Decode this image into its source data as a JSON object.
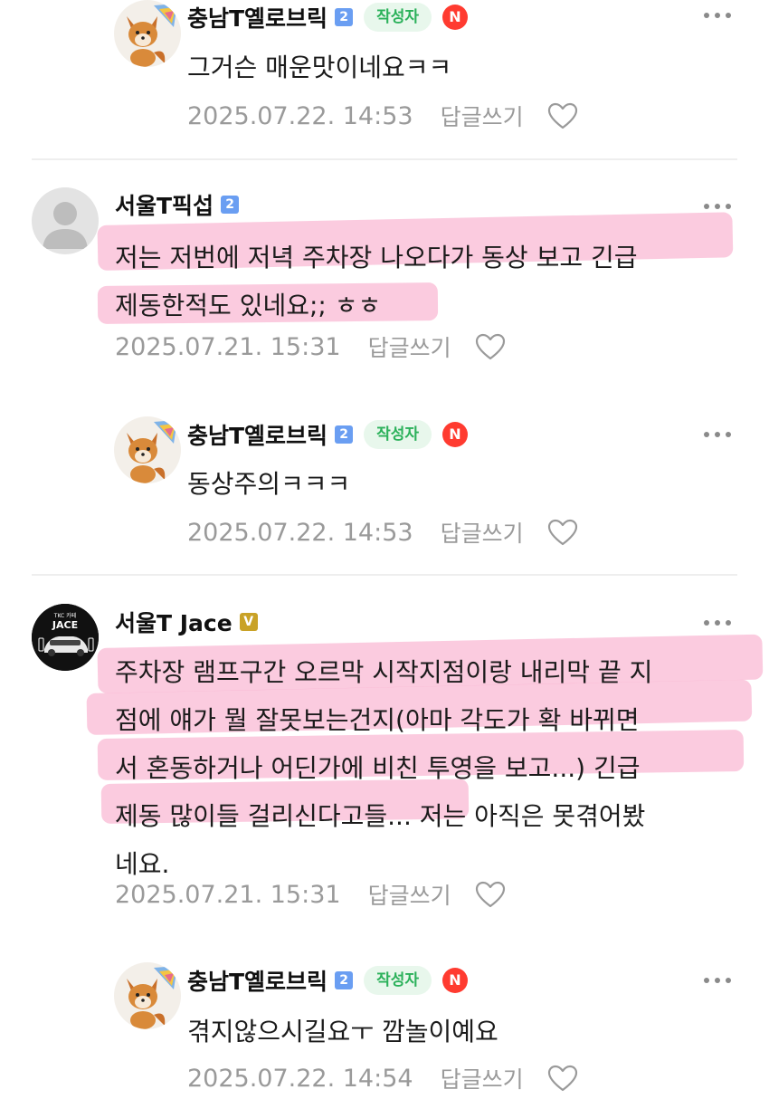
{
  "comments": [
    {
      "author": "충남T옐로브릭",
      "grade": "2",
      "writer_badge": "작성자",
      "new_badge": "N",
      "text_lines": [
        "그거슨 매운맛이네요ㅋㅋ"
      ],
      "date": "2025.07.22. 14:53",
      "reply_label": "답글쓰기",
      "avatar_icon": "fox-avatar"
    },
    {
      "author": "서울T픽섭",
      "grade": "2",
      "text_lines": [
        "저는 저번에 저녁 주차장 나오다가 동상 보고 긴급",
        "제동한적도 있네요;; ㅎㅎ"
      ],
      "date": "2025.07.21. 15:31",
      "reply_label": "답글쓰기",
      "avatar_icon": "default-user-avatar"
    },
    {
      "author": "충남T옐로브릭",
      "grade": "2",
      "writer_badge": "작성자",
      "new_badge": "N",
      "text_lines": [
        "동상주의ㅋㅋㅋ"
      ],
      "date": "2025.07.22. 14:53",
      "reply_label": "답글쓰기",
      "avatar_icon": "fox-avatar"
    },
    {
      "author": "서울T Jace",
      "grade": "V",
      "avatar_label_top": "TKC 카페",
      "avatar_label": "JACE",
      "text_lines": [
        "주차장 램프구간 오르막 시작지점이랑 내리막 끝 지",
        "점에 얘가 뭘 잘못보는건지(아마 각도가 확 바뀌면",
        "서 혼동하거나 어딘가에 비친 투영을 보고...) 긴급",
        "제동 많이들 걸리신다고들... 저는 아직은 못겪어봤",
        "네요."
      ],
      "date": "2025.07.21. 15:31",
      "reply_label": "답글쓰기",
      "avatar_icon": "tesla-car-avatar"
    },
    {
      "author": "충남T옐로브릭",
      "grade": "2",
      "writer_badge": "작성자",
      "new_badge": "N",
      "text_lines": [
        "겪지않으시길요ㅜ 깜놀이예요"
      ],
      "date": "2025.07.22. 14:54",
      "reply_label": "답글쓰기",
      "avatar_icon": "fox-avatar"
    }
  ],
  "colors": {
    "highlight": "#f7a0c4",
    "writer_badge_bg": "#e8f7ec",
    "writer_badge_text": "#2bb15a",
    "new_badge": "#ff3b30",
    "grade_blue": "#6a9ef2",
    "grade_gold": "#c9a227",
    "meta_text": "#9a9a9a"
  }
}
